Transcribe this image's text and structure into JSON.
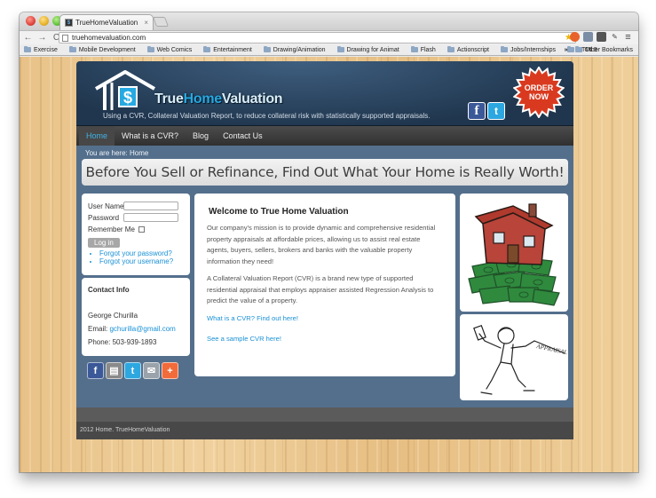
{
  "browser": {
    "tab_title": "TrueHomeValuation",
    "tab_close": "×",
    "url": "truehomevaluation.com",
    "back": "←",
    "forward": "→",
    "reload": "C",
    "menu": "≡",
    "bookmarks": [
      "Exercise",
      "Mobile Development",
      "Web Comics",
      "Entertainment",
      "Drawing/Animation",
      "Drawing for Animat",
      "Flash",
      "Actionscript",
      "Jobs/Internships",
      "HTML5"
    ],
    "more_chevron": "»",
    "other_bookmarks": "Other Bookmarks"
  },
  "site": {
    "logo_part1": "True",
    "logo_part2": "Home",
    "logo_part3": "Valuation",
    "tagline": "Using a CVR, Collateral Valuation Report, to reduce collateral risk with statistically supported appraisals.",
    "badge_line1": "ORDER",
    "badge_line2": "NOW",
    "fb_glyph": "f",
    "tw_glyph": "t",
    "nav": [
      "Home",
      "What is a CVR?",
      "Blog",
      "Contact Us"
    ],
    "breadcrumb": "You are here:  Home",
    "banner": "Before You Sell or Refinance, Find Out What Your Home is Really Worth!"
  },
  "login": {
    "username_label": "User Name",
    "password_label": "Password",
    "remember_label": "Remember Me",
    "button": "Log in",
    "forgot_password": "Forgot your password?",
    "forgot_username": "Forgot your username?"
  },
  "contact": {
    "title": "Contact Info",
    "name": "George Churilla",
    "email_label": "Email: ",
    "email": "gchurilla@gmail.com",
    "phone": "Phone: 503-939-1893"
  },
  "share": {
    "glyphs": [
      "f",
      "▤",
      "t",
      "✉",
      "+"
    ],
    "colors": [
      "#3b5998",
      "#8a8a8a",
      "#2da7e0",
      "#9aa3ab",
      "#f26b3a"
    ]
  },
  "main": {
    "title": "Welcome to True Home Valuation",
    "p1": "Our company's mission is to provide dynamic and comprehensive residential property appraisals at affordable prices, allowing us to assist real estate agents, buyers, sellers, brokers and banks with the valuable property information they need!",
    "p2": "A Collateral Valuation Report (CVR) is a brand new type of supported residential appraisal that employs appraiser assisted Regression Analysis to predict the value of a property.",
    "link1": "What is a CVR? Find out here!",
    "link2": "See a sample CVR here!"
  },
  "illustration": {
    "sign_text": "APPRAISAL CVR"
  },
  "footer": {
    "text": "2012 Home. TrueHomeValuation"
  },
  "colors": {
    "accent": "#1b91d6",
    "header": "#20364e",
    "site_bg": "#546f8c",
    "badge": "#d93a1f"
  }
}
